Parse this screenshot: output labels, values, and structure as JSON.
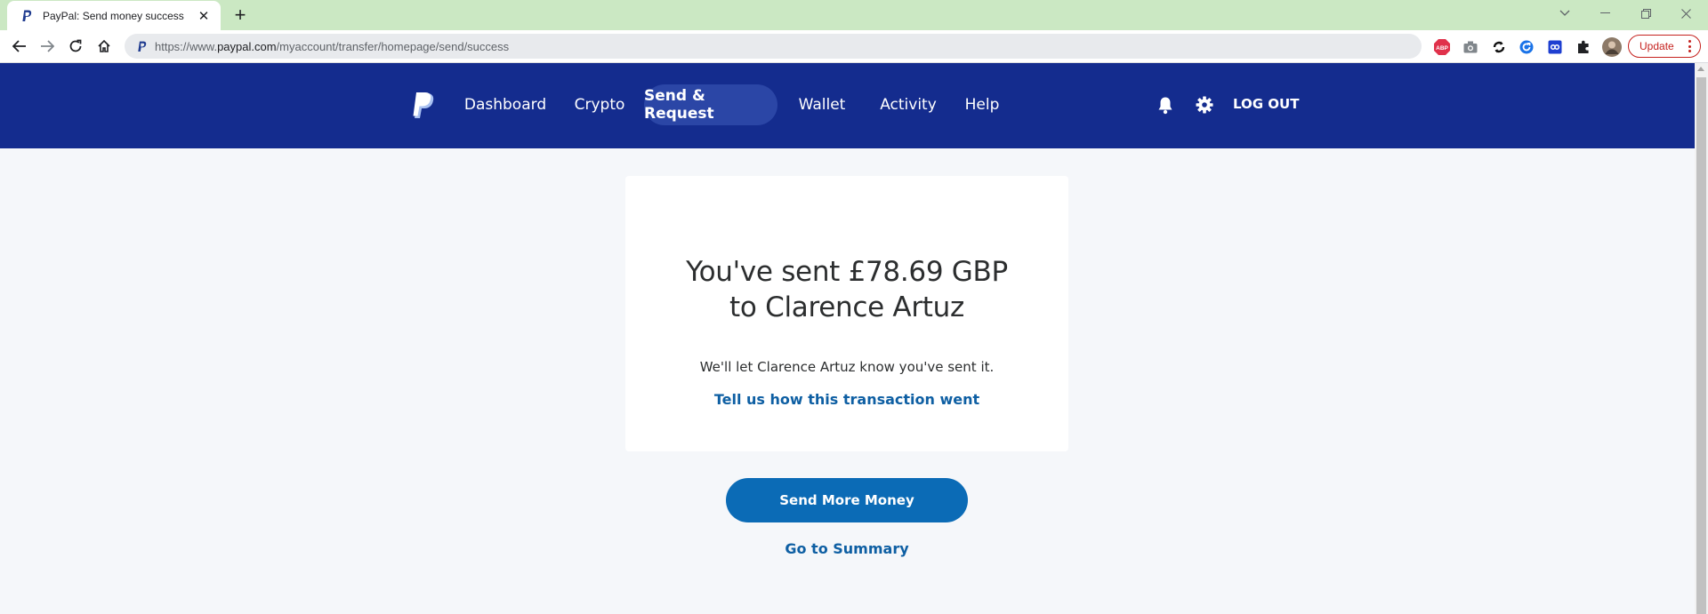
{
  "browser": {
    "tab_title": "PayPal: Send money success",
    "url_prefix": "https://www.",
    "url_host": "paypal.com",
    "url_path": "/myaccount/transfer/homepage/send/success",
    "update_label": "Update",
    "extensions": [
      "adblock-icon",
      "camera-icon",
      "sync-icon",
      "refresh-extension-icon",
      "link-extension-icon",
      "puzzle-icon",
      "profile-avatar"
    ]
  },
  "header": {
    "nav": [
      {
        "label": "Dashboard",
        "active": false
      },
      {
        "label": "Crypto",
        "active": false
      },
      {
        "label": "Send & Request",
        "active": true
      },
      {
        "label": "Wallet",
        "active": false
      },
      {
        "label": "Activity",
        "active": false
      },
      {
        "label": "Help",
        "active": false
      }
    ],
    "logout_label": "LOG OUT"
  },
  "success": {
    "title_line1": "You've sent £78.69 GBP",
    "title_line2": "to Clarence Artuz",
    "message": "We'll let Clarence Artuz know you've sent it.",
    "feedback_link": "Tell us how this transaction went",
    "send_more_label": "Send More Money",
    "summary_link": "Go to Summary"
  },
  "colors": {
    "header_bg": "#142c8e",
    "active_nav_bg": "#2b46a6",
    "primary_button": "#0b6bb6",
    "link": "#0e5fa3",
    "tab_strip": "#cbe8c3"
  }
}
